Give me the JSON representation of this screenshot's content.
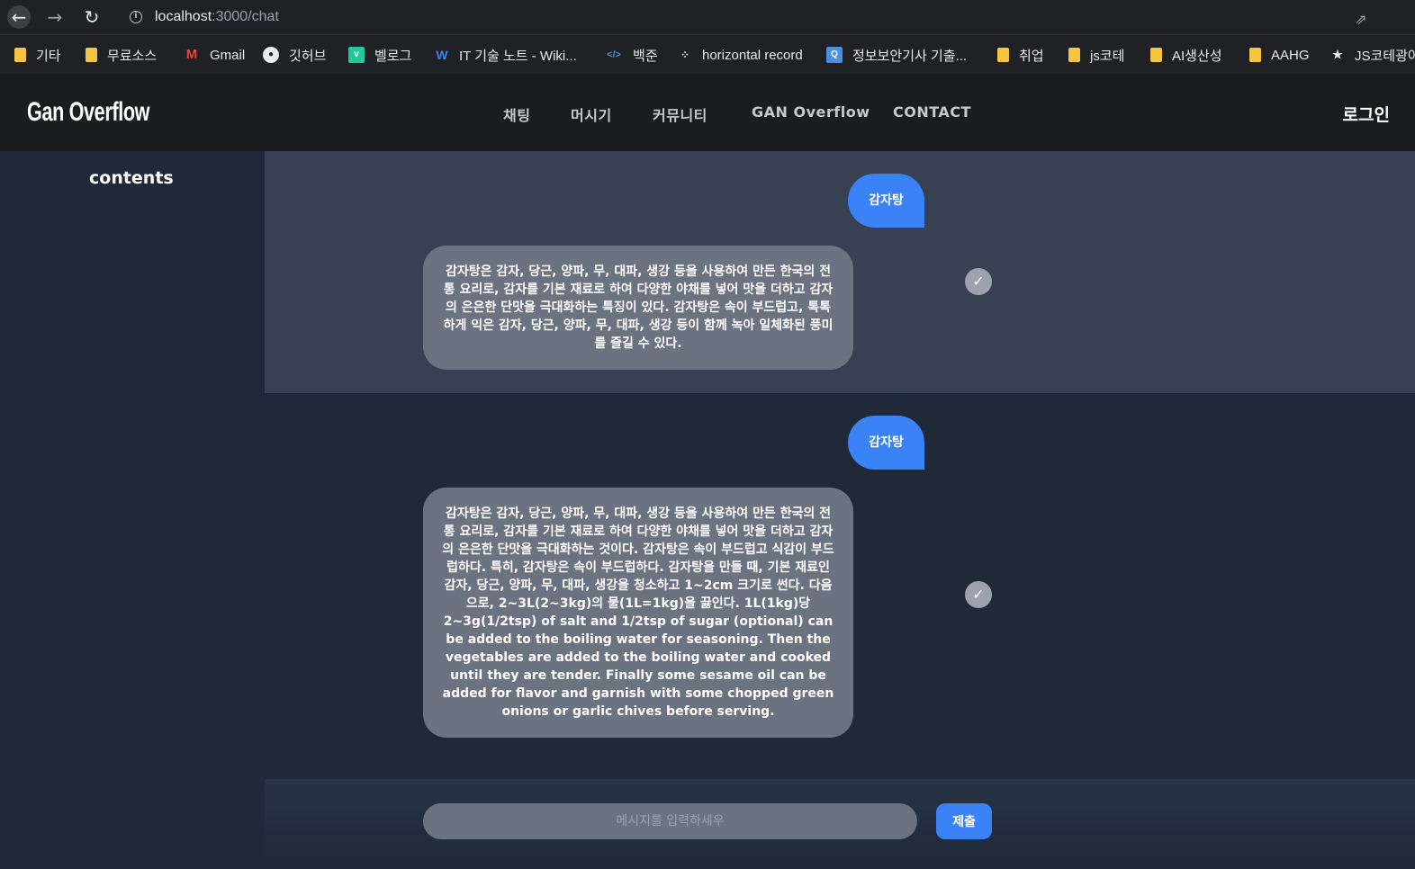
{
  "browser": {
    "url_host": "localhost",
    "url_path": ":3000/chat",
    "bookmarks": [
      {
        "label": "기타",
        "icon": "folder"
      },
      {
        "label": "무료소스",
        "icon": "folder"
      },
      {
        "label": "Gmail",
        "icon": "gmail"
      },
      {
        "label": "깃허브",
        "icon": "github"
      },
      {
        "label": "벨로그",
        "icon": "velog"
      },
      {
        "label": "IT 기술 노트 - Wiki...",
        "icon": "wiki"
      },
      {
        "label": "백준",
        "icon": "code"
      },
      {
        "label": "horizontal record",
        "icon": "dots"
      },
      {
        "label": "정보보안기사 기출...",
        "icon": "q"
      },
      {
        "label": "취업",
        "icon": "folder"
      },
      {
        "label": "js코테",
        "icon": "folder"
      },
      {
        "label": "AI생산성",
        "icon": "folder"
      },
      {
        "label": "AAHG",
        "icon": "folder"
      },
      {
        "label": "JS코테광야",
        "icon": "star"
      }
    ]
  },
  "header": {
    "logo": "Gan Overflow",
    "menu": [
      "채팅",
      "머시기",
      "커뮤니티",
      "GAN Overflow",
      "CONTACT"
    ],
    "login": "로그인"
  },
  "sidebar": {
    "title": "contents"
  },
  "chat": {
    "messages": [
      {
        "question": "감자탕",
        "answer": "감자탕은 감자, 당근, 양파, 무, 대파, 생강 등을 사용하여 만든 한국의 전통 요리로, 감자를 기본 재료로 하여 다양한 야채를 넣어 맛을 더하고 감자의 은은한 단맛을 극대화하는 특징이 있다. 감자탕은 속이 부드럽고, 톡톡하게 익은 감자, 당근, 양파, 무, 대파, 생강 등이 함께 녹아 일체화된 풍미를 즐길 수 있다."
      },
      {
        "question": "감자탕",
        "answer": "감자탕은 감자, 당근, 양파, 무, 대파, 생강 등을 사용하여 만든 한국의 전통 요리로, 감자를 기본 재료로 하여 다양한 야채를 넣어 맛을 더하고 감자의 은은한 단맛을 극대화하는 것이다. 감자탕은 속이 부드럽고 식감이 부드럽하다. 특히, 감자탕은 속이 부드럽하다. 감자탕을 만들 때, 기본 재료인 감자, 당근, 양파, 무, 대파, 생강을 청소하고 1~2cm 크기로 썬다. 다음으로, 2~3L(2~3kg)의 물(1L=1kg)을 끓인다. 1L(1kg)당 2~3g(1/2tsp) of salt and 1/2tsp of sugar (optional) can be added to the boiling water for seasoning. Then the vegetables are added to the boiling water and cooked until they are tender. Finally some sesame oil can be added for flavor and garnish with some chopped green onions or garlic chives before serving."
      }
    ],
    "input_placeholder": "메시지를 입력하세우",
    "submit_label": "제출"
  },
  "colors": {
    "accent": "#3b82f6",
    "bot_bubble": "#6b7280",
    "background": "#1f2937"
  }
}
